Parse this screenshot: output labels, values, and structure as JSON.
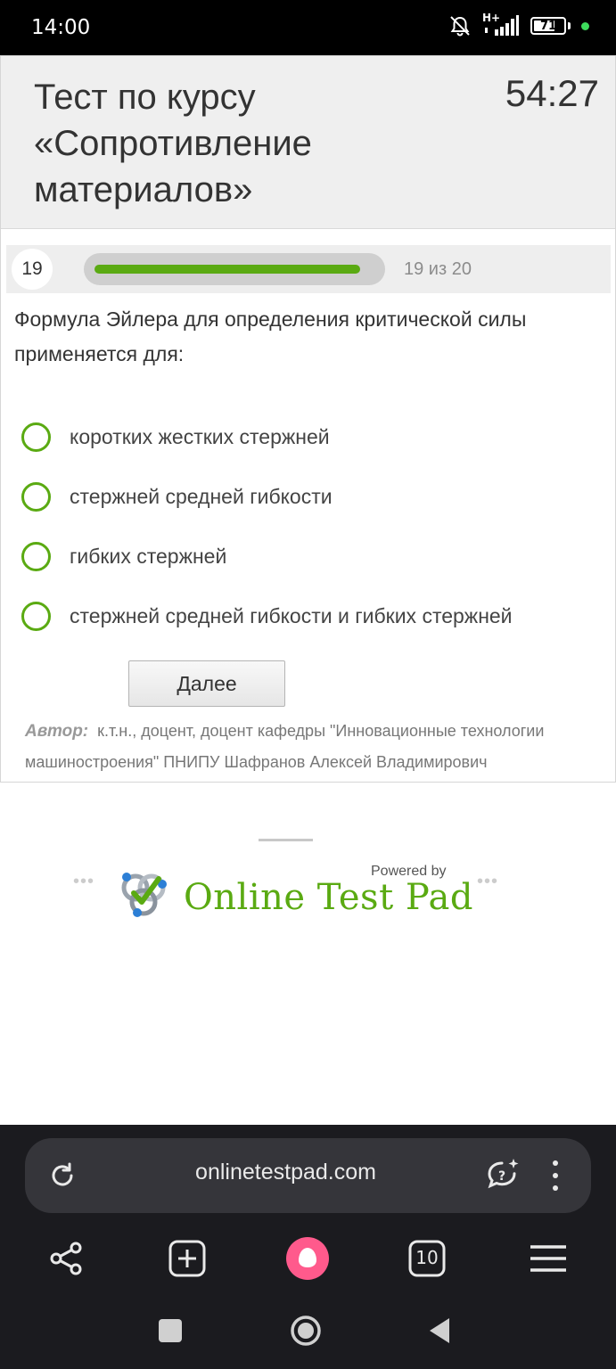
{
  "status_bar": {
    "time": "14:00",
    "network": "H+",
    "battery": "71",
    "battery_level": 0.71
  },
  "test": {
    "title": "Тест по курсу «Сопротивление материалов»",
    "timer": "54:27",
    "question_number": "19",
    "progress_label": "19 из 20",
    "progress": 0.95,
    "question": "Формула Эйлера для определения критической силы применяется для:",
    "options": [
      {
        "label": "коротких жестких стержней",
        "selected": false
      },
      {
        "label": "стержней средней гибкости",
        "selected": false
      },
      {
        "label": "гибких стержней",
        "selected": false
      },
      {
        "label": "стержней средней гибкости и гибких стержней",
        "selected": false
      }
    ],
    "next_label": "Далее",
    "author_label": "Автор:",
    "author_text": "к.т.н., доцент, доцент кафедры \"Инновационные технологии машиностроения\" ПНИПУ Шафранов Алексей Владимирович"
  },
  "branding": {
    "powered_by": "Powered by",
    "name": "Online Test Pad",
    "color": "#5aaa12"
  },
  "browser": {
    "url": "onlinetestpad.com",
    "tabs_count": "10",
    "icons": [
      "reload-icon",
      "assistant-icon",
      "menu-dots-icon",
      "share-icon",
      "new-tab-icon",
      "alice-icon",
      "tabs-icon",
      "hamburger-icon"
    ]
  },
  "system_nav": {
    "icons": [
      "recents-icon",
      "home-icon",
      "back-icon"
    ]
  }
}
